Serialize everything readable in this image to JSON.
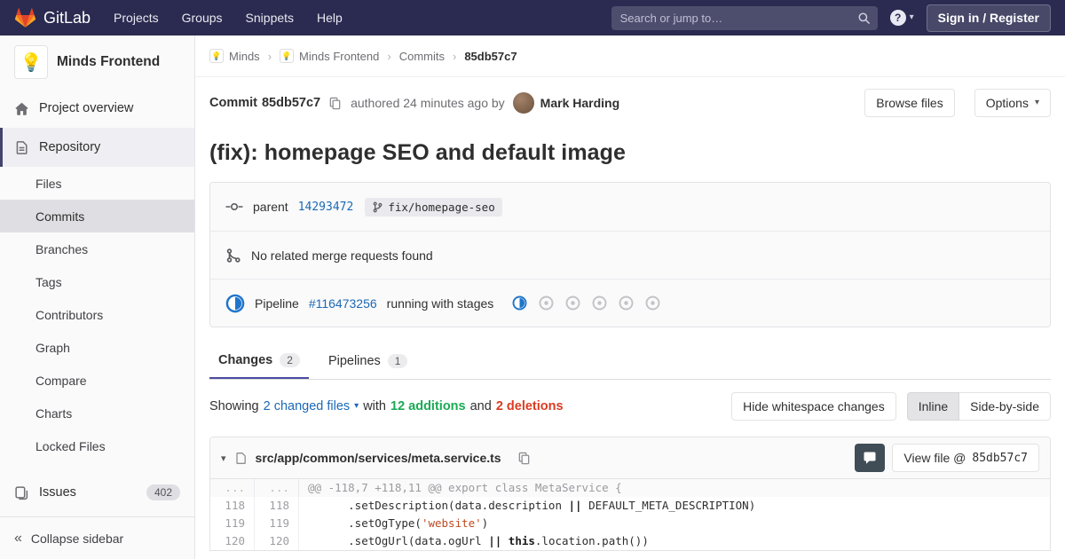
{
  "colors": {
    "navbar_bg": "#2b2b51",
    "link_blue": "#1b69b6",
    "additions_green": "#1aaa55",
    "deletions_red": "#db3b21",
    "pipeline_running_blue": "#1f75cb",
    "tab_active_underline": "#4b4ba3",
    "code_string": "#bd4a21"
  },
  "icons": {
    "caret_down": "▾",
    "collapse": "«",
    "breadcrumb_separator": "›",
    "help": "?"
  },
  "navbar": {
    "brand": "GitLab",
    "links": [
      "Projects",
      "Groups",
      "Snippets",
      "Help"
    ],
    "search_placeholder": "Search or jump to…",
    "sign_in_label": "Sign in / Register"
  },
  "sidebar": {
    "project_avatar": "💡",
    "project_name": "Minds Frontend",
    "overview_label": "Project overview",
    "repository_label": "Repository",
    "repository_items": [
      "Files",
      "Commits",
      "Branches",
      "Tags",
      "Contributors",
      "Graph",
      "Compare",
      "Charts",
      "Locked Files"
    ],
    "issues_label": "Issues",
    "issues_count": "402",
    "collapse_label": "Collapse sidebar"
  },
  "breadcrumb": {
    "items": [
      "Minds",
      "Minds Frontend",
      "Commits",
      "85db57c7"
    ]
  },
  "commit": {
    "label": "Commit",
    "sha": "85db57c7",
    "authored_text": "authored 24 minutes ago by",
    "author": "Mark Harding",
    "browse_files_label": "Browse files",
    "options_label": "Options",
    "title": "(fix): homepage SEO and default image",
    "parent_label": "parent",
    "parent_sha": "14293472",
    "branch_ref": "fix/homepage-seo",
    "no_mr_text": "No related merge requests found",
    "pipeline_label": "Pipeline",
    "pipeline_id": "#116473256",
    "pipeline_status_text": "running with stages"
  },
  "tabs": [
    {
      "label": "Changes",
      "count": "2"
    },
    {
      "label": "Pipelines",
      "count": "1"
    }
  ],
  "summary": {
    "showing": "Showing",
    "changed_files": "2 changed files",
    "with_text": "with",
    "additions": "12 additions",
    "and_text": "and",
    "deletions": "2 deletions",
    "hide_whitespace_label": "Hide whitespace changes",
    "inline_label": "Inline",
    "side_by_side_label": "Side-by-side"
  },
  "file_diff": {
    "path": "src/app/common/services/meta.service.ts",
    "view_file_label": "View file @",
    "view_file_sha": "85db57c7",
    "lines": [
      {
        "old": "...",
        "new": "...",
        "segments": [
          {
            "t": "@@ -118,7 +118,11 @@ export class MetaService {"
          }
        ]
      },
      {
        "old": "118",
        "new": "118",
        "segments": [
          {
            "t": "      .setDescription(data.description "
          },
          {
            "t": "||"
          },
          {
            "t": " DEFAULT_META_DESCRIPTION)"
          }
        ]
      },
      {
        "old": "119",
        "new": "119",
        "segments": [
          {
            "t": "      .setOgType("
          },
          {
            "t": "'website'"
          },
          {
            "t": ")"
          }
        ]
      },
      {
        "old": "120",
        "new": "120",
        "segments": [
          {
            "t": "      .setOgUrl(data.ogUrl "
          },
          {
            "t": "||"
          },
          {
            "t": " "
          },
          {
            "t": "this"
          },
          {
            "t": ".location.path())"
          }
        ]
      }
    ]
  }
}
